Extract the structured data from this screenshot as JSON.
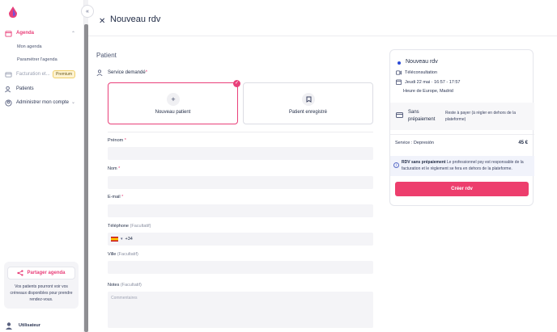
{
  "sidebar": {
    "items": [
      {
        "label": "Agenda",
        "icon": "calendar-icon"
      },
      {
        "label": "Facturation et...",
        "icon": "invoice-icon",
        "badge": "Premium"
      },
      {
        "label": "Patients",
        "icon": "users-icon"
      },
      {
        "label": "Administrer mon compte",
        "icon": "user-settings-icon"
      }
    ],
    "subitems": [
      {
        "label": "Mon agenda"
      },
      {
        "label": "Paramétrer l'agenda"
      }
    ],
    "share": {
      "button_label": "Partager agenda",
      "text": "Vos patients pourront voir vos créneaux disponibles pour prendre rendez-vous."
    },
    "user": {
      "label": "Utilisateur"
    }
  },
  "header": {
    "title": "Nouveau rdv"
  },
  "form": {
    "section_title": "Patient",
    "service_label": "Service demandé",
    "service_required": "*",
    "options": [
      {
        "label": "Nouveau patient",
        "selected": true
      },
      {
        "label": "Patient enregistré",
        "selected": false
      }
    ],
    "fields": {
      "prenom": {
        "label": "Prénom",
        "req": "*"
      },
      "nom": {
        "label": "Nom",
        "req": "*"
      },
      "email": {
        "label": "E-mail",
        "req": "*"
      },
      "telephone": {
        "label": "Téléphone",
        "optional": "(Facultatif)",
        "prefix": "+34"
      },
      "ville": {
        "label": "Ville",
        "optional": "(Facultatif)"
      },
      "notes": {
        "label": "Notes",
        "optional": "(Facultatif)",
        "placeholder": "Commentaires"
      }
    }
  },
  "summary": {
    "title": "Nouveau rdv",
    "type": "Téléconsultation",
    "datetime": "Jeudi 22 mai · 16:57 - 17:57",
    "timezone": "Heure de Europe, Madrid",
    "payment_title": "Sans prépaiement",
    "payment_text": "Reste à payer (à régler en dehors de la plateforme)",
    "service_label": "Service : Depresión",
    "price": "45 €",
    "note_bold": "RDV sans prépaiement",
    "note_text": " Le professionnel psy est responsable de la facturation et le règlement se fera en dehors de la plateforme.",
    "create_button": "Créer rdv"
  },
  "colors": {
    "accent": "#e9407a",
    "button": "#ed3e6d",
    "premium_bg": "#fdf3d2"
  }
}
